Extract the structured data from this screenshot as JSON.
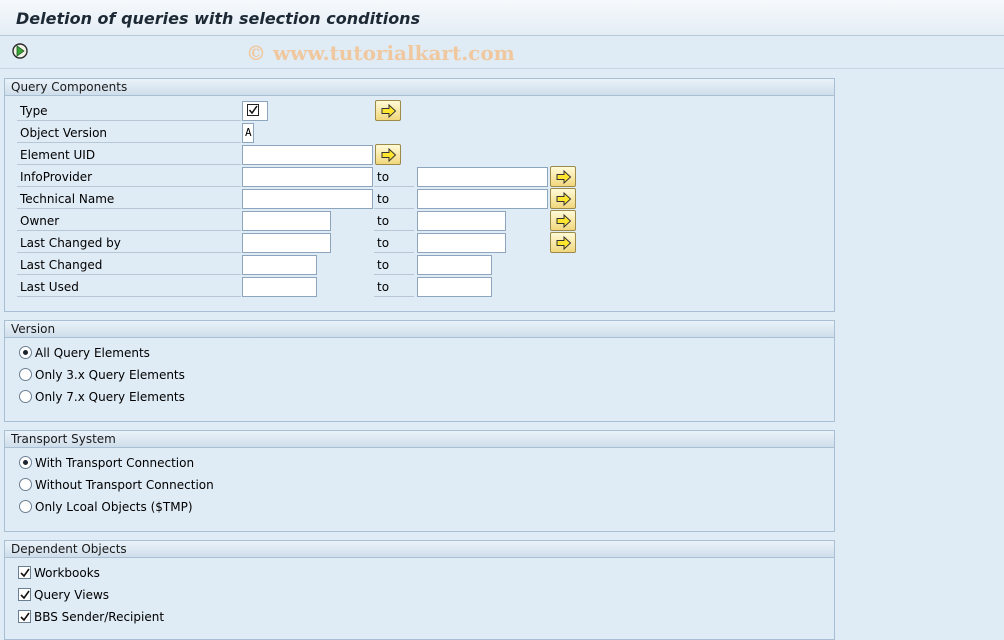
{
  "title": "Deletion of queries with selection conditions",
  "watermark": "© www.tutorialkart.com",
  "query_components": {
    "header": "Query Components",
    "type_label": "Type",
    "object_version_label": "Object Version",
    "object_version_value": "A",
    "element_uid_label": "Element UID",
    "infoprovider_label": "InfoProvider",
    "technical_name_label": "Technical Name",
    "owner_label": "Owner",
    "last_changed_by_label": "Last Changed by",
    "last_changed_label": "Last Changed",
    "last_used_label": "Last Used",
    "to_label": "to"
  },
  "version": {
    "header": "Version",
    "options": [
      "All Query Elements",
      "Only 3.x Query Elements",
      "Only 7.x Query Elements"
    ],
    "selected": "All Query Elements"
  },
  "transport": {
    "header": "Transport System",
    "options": [
      "With Transport Connection",
      "Without Transport Connection",
      "Only Lcoal Objects ($TMP)"
    ],
    "selected": "With Transport Connection"
  },
  "dependent": {
    "header": "Dependent Objects",
    "items": [
      "Workbooks",
      "Query Views",
      "BBS Sender/Recipient"
    ]
  }
}
